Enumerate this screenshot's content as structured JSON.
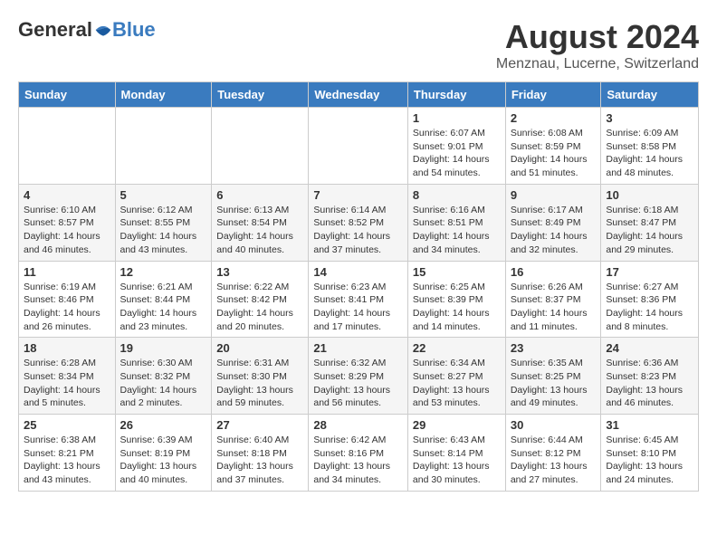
{
  "header": {
    "logo_general": "General",
    "logo_blue": "Blue",
    "month_title": "August 2024",
    "subtitle": "Menznau, Lucerne, Switzerland"
  },
  "weekdays": [
    "Sunday",
    "Monday",
    "Tuesday",
    "Wednesday",
    "Thursday",
    "Friday",
    "Saturday"
  ],
  "weeks": [
    [
      {
        "day": "",
        "info": ""
      },
      {
        "day": "",
        "info": ""
      },
      {
        "day": "",
        "info": ""
      },
      {
        "day": "",
        "info": ""
      },
      {
        "day": "1",
        "info": "Sunrise: 6:07 AM\nSunset: 9:01 PM\nDaylight: 14 hours\nand 54 minutes."
      },
      {
        "day": "2",
        "info": "Sunrise: 6:08 AM\nSunset: 8:59 PM\nDaylight: 14 hours\nand 51 minutes."
      },
      {
        "day": "3",
        "info": "Sunrise: 6:09 AM\nSunset: 8:58 PM\nDaylight: 14 hours\nand 48 minutes."
      }
    ],
    [
      {
        "day": "4",
        "info": "Sunrise: 6:10 AM\nSunset: 8:57 PM\nDaylight: 14 hours\nand 46 minutes."
      },
      {
        "day": "5",
        "info": "Sunrise: 6:12 AM\nSunset: 8:55 PM\nDaylight: 14 hours\nand 43 minutes."
      },
      {
        "day": "6",
        "info": "Sunrise: 6:13 AM\nSunset: 8:54 PM\nDaylight: 14 hours\nand 40 minutes."
      },
      {
        "day": "7",
        "info": "Sunrise: 6:14 AM\nSunset: 8:52 PM\nDaylight: 14 hours\nand 37 minutes."
      },
      {
        "day": "8",
        "info": "Sunrise: 6:16 AM\nSunset: 8:51 PM\nDaylight: 14 hours\nand 34 minutes."
      },
      {
        "day": "9",
        "info": "Sunrise: 6:17 AM\nSunset: 8:49 PM\nDaylight: 14 hours\nand 32 minutes."
      },
      {
        "day": "10",
        "info": "Sunrise: 6:18 AM\nSunset: 8:47 PM\nDaylight: 14 hours\nand 29 minutes."
      }
    ],
    [
      {
        "day": "11",
        "info": "Sunrise: 6:19 AM\nSunset: 8:46 PM\nDaylight: 14 hours\nand 26 minutes."
      },
      {
        "day": "12",
        "info": "Sunrise: 6:21 AM\nSunset: 8:44 PM\nDaylight: 14 hours\nand 23 minutes."
      },
      {
        "day": "13",
        "info": "Sunrise: 6:22 AM\nSunset: 8:42 PM\nDaylight: 14 hours\nand 20 minutes."
      },
      {
        "day": "14",
        "info": "Sunrise: 6:23 AM\nSunset: 8:41 PM\nDaylight: 14 hours\nand 17 minutes."
      },
      {
        "day": "15",
        "info": "Sunrise: 6:25 AM\nSunset: 8:39 PM\nDaylight: 14 hours\nand 14 minutes."
      },
      {
        "day": "16",
        "info": "Sunrise: 6:26 AM\nSunset: 8:37 PM\nDaylight: 14 hours\nand 11 minutes."
      },
      {
        "day": "17",
        "info": "Sunrise: 6:27 AM\nSunset: 8:36 PM\nDaylight: 14 hours\nand 8 minutes."
      }
    ],
    [
      {
        "day": "18",
        "info": "Sunrise: 6:28 AM\nSunset: 8:34 PM\nDaylight: 14 hours\nand 5 minutes."
      },
      {
        "day": "19",
        "info": "Sunrise: 6:30 AM\nSunset: 8:32 PM\nDaylight: 14 hours\nand 2 minutes."
      },
      {
        "day": "20",
        "info": "Sunrise: 6:31 AM\nSunset: 8:30 PM\nDaylight: 13 hours\nand 59 minutes."
      },
      {
        "day": "21",
        "info": "Sunrise: 6:32 AM\nSunset: 8:29 PM\nDaylight: 13 hours\nand 56 minutes."
      },
      {
        "day": "22",
        "info": "Sunrise: 6:34 AM\nSunset: 8:27 PM\nDaylight: 13 hours\nand 53 minutes."
      },
      {
        "day": "23",
        "info": "Sunrise: 6:35 AM\nSunset: 8:25 PM\nDaylight: 13 hours\nand 49 minutes."
      },
      {
        "day": "24",
        "info": "Sunrise: 6:36 AM\nSunset: 8:23 PM\nDaylight: 13 hours\nand 46 minutes."
      }
    ],
    [
      {
        "day": "25",
        "info": "Sunrise: 6:38 AM\nSunset: 8:21 PM\nDaylight: 13 hours\nand 43 minutes."
      },
      {
        "day": "26",
        "info": "Sunrise: 6:39 AM\nSunset: 8:19 PM\nDaylight: 13 hours\nand 40 minutes."
      },
      {
        "day": "27",
        "info": "Sunrise: 6:40 AM\nSunset: 8:18 PM\nDaylight: 13 hours\nand 37 minutes."
      },
      {
        "day": "28",
        "info": "Sunrise: 6:42 AM\nSunset: 8:16 PM\nDaylight: 13 hours\nand 34 minutes."
      },
      {
        "day": "29",
        "info": "Sunrise: 6:43 AM\nSunset: 8:14 PM\nDaylight: 13 hours\nand 30 minutes."
      },
      {
        "day": "30",
        "info": "Sunrise: 6:44 AM\nSunset: 8:12 PM\nDaylight: 13 hours\nand 27 minutes."
      },
      {
        "day": "31",
        "info": "Sunrise: 6:45 AM\nSunset: 8:10 PM\nDaylight: 13 hours\nand 24 minutes."
      }
    ]
  ]
}
